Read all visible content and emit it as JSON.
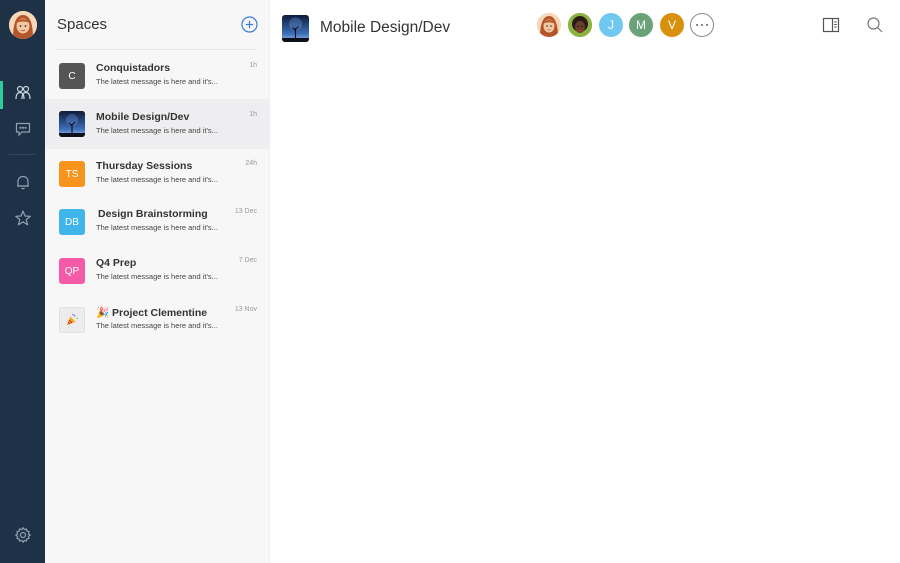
{
  "sidebar": {
    "nav": [
      {
        "name": "people",
        "icon": "people-icon"
      },
      {
        "name": "chat",
        "icon": "chat-bubble-icon"
      },
      {
        "name": "notifications",
        "icon": "bell-icon"
      },
      {
        "name": "favorites",
        "icon": "star-icon"
      }
    ],
    "settings_icon": "gear-icon",
    "accent": "#2ecc9a",
    "background": "#1f3147"
  },
  "spaces": {
    "title": "Spaces",
    "items": [
      {
        "initials": "C",
        "name": "Conquistadors",
        "message": "The latest message is here and it's...",
        "time": "1h",
        "color": "#555555"
      },
      {
        "initials": "",
        "name": "Mobile Design/Dev",
        "message": "The latest message is here and it's...",
        "time": "1h",
        "color": "#1d2f56"
      },
      {
        "initials": "TS",
        "name": "Thursday Sessions",
        "message": "The latest message is here and it's...",
        "time": "24h",
        "color": "#f7941d"
      },
      {
        "initials": "DB",
        "name": "Design Brainstorming",
        "message": "The latest message is here and it's...",
        "time": "13 Dec",
        "color": "#3fb5ea"
      },
      {
        "initials": "QP",
        "name": "Q4 Prep",
        "message": "The latest message is here and it's...",
        "time": "7 Dec",
        "color": "#f45aa8"
      },
      {
        "initials": "",
        "name": "🎉 Project Clementine",
        "message": "The latest message is here and it's...",
        "time": "13 Nov",
        "color": "#ececec"
      }
    ]
  },
  "main": {
    "title": "Mobile Design/Dev",
    "members": [
      {
        "initial": "",
        "color": "#f2c9a8"
      },
      {
        "initial": "",
        "color": "#7aa33a"
      },
      {
        "initial": "J",
        "color": "#6fc8ef"
      },
      {
        "initial": "M",
        "color": "#6aa27a"
      },
      {
        "initial": "V",
        "color": "#d9900d"
      }
    ]
  }
}
